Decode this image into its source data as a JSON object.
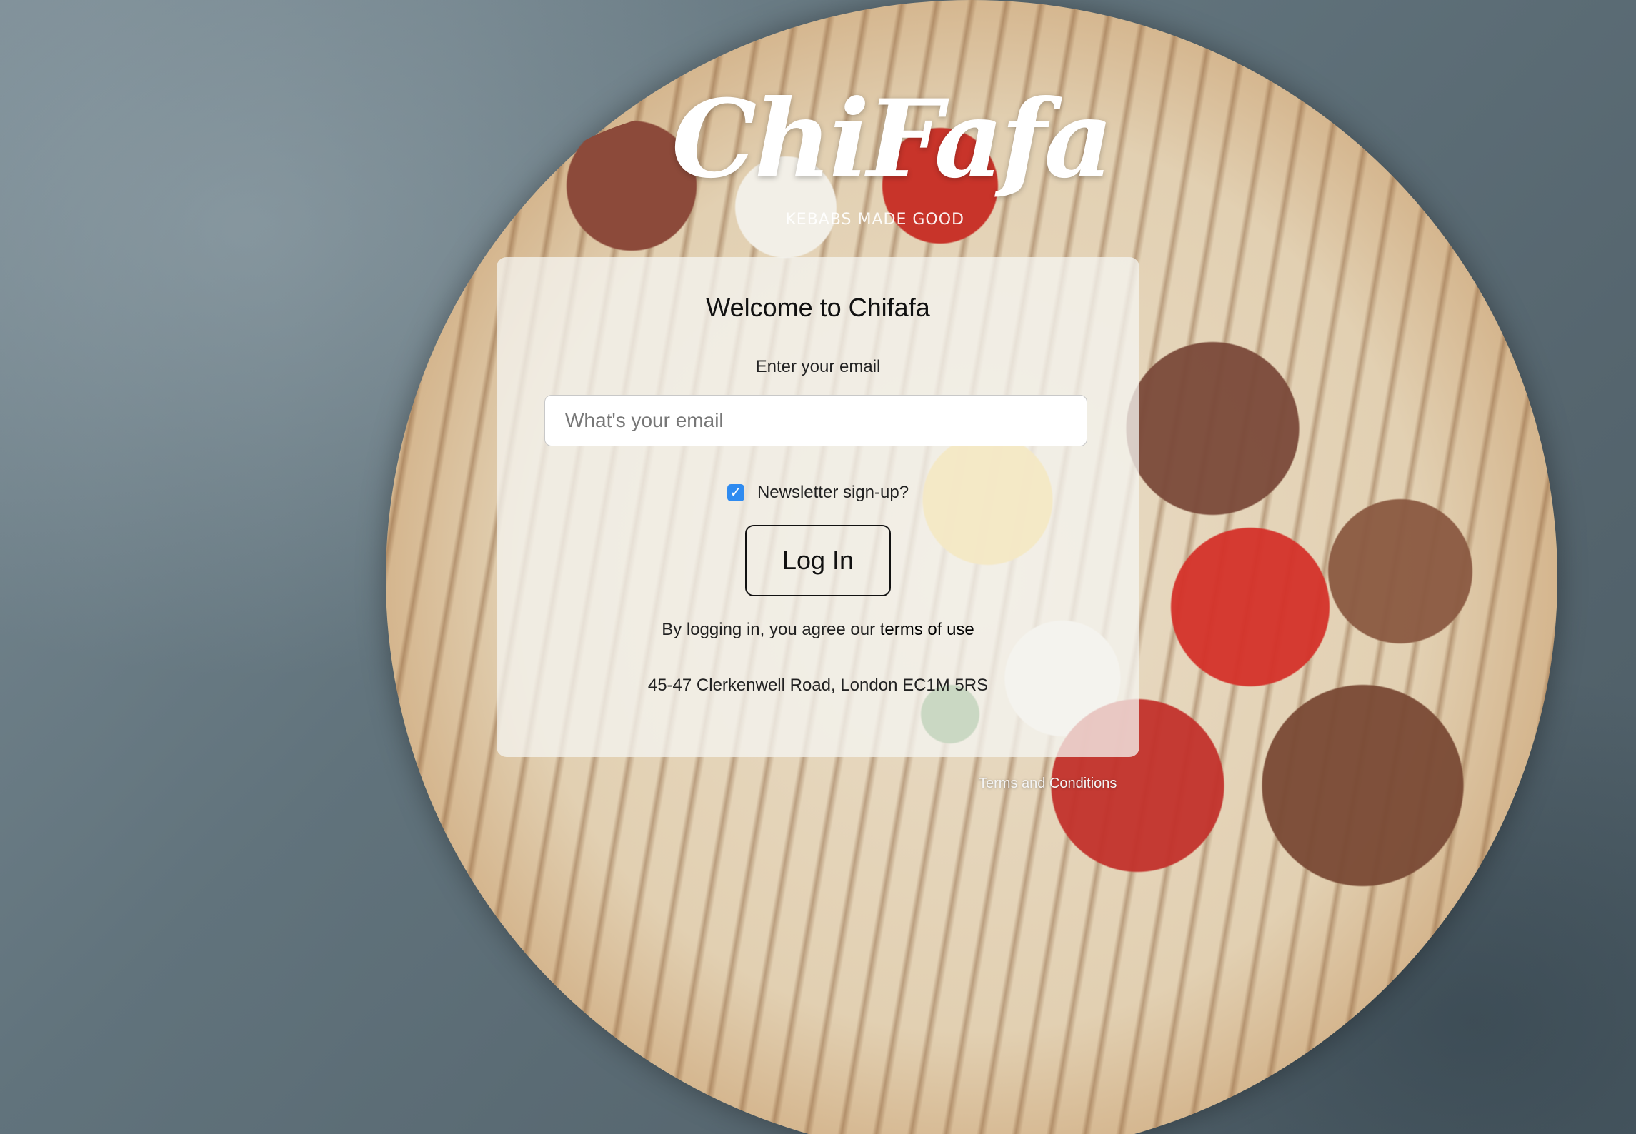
{
  "brand": {
    "logo_text": "ChiFafa",
    "tagline": "KEBABS MADE GOOD"
  },
  "login": {
    "title": "Welcome to Chifafa",
    "email_label": "Enter your email",
    "email_placeholder": "What's your email",
    "email_value": "",
    "newsletter_label": "Newsletter sign-up?",
    "newsletter_checked": true,
    "submit_label": "Log In",
    "terms_prefix": "By logging in, you agree our ",
    "terms_link": "terms of use",
    "address": "45-47 Clerkenwell Road, London EC1M 5RS"
  },
  "footer": {
    "terms_and_conditions": "Terms and Conditions"
  },
  "colors": {
    "checkbox_accent": "#2f8bf0",
    "card_background": "rgba(244,244,240,0.76)"
  }
}
